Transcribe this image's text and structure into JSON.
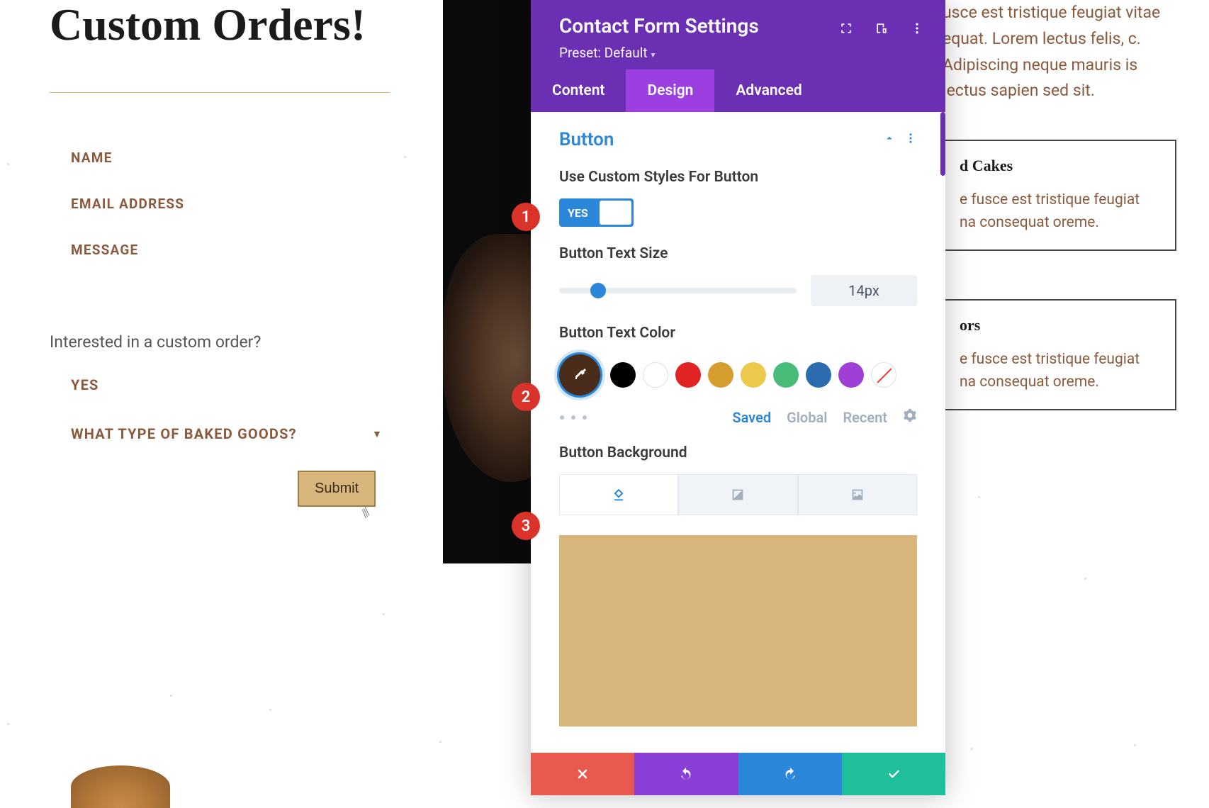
{
  "page": {
    "heading": "Custom Orders!",
    "form": {
      "name_label": "NAME",
      "email_label": "EMAIL ADDRESS",
      "message_label": "MESSAGE",
      "question": "Interested in a custom order?",
      "yes_option": "YES",
      "select_label": "WHAT TYPE OF BAKED GOODS?",
      "submit_label": "Submit"
    },
    "right_paragraph": "usce est tristique feugiat vitae equat. Lorem lectus felis, c. Adipiscing neque mauris is lectus sapien sed sit.",
    "card1": {
      "title": "d Cakes",
      "text": "e fusce est tristique feugiat na consequat oreme."
    },
    "card2": {
      "title": "ors",
      "text": "e fusce est tristique feugiat na consequat oreme."
    }
  },
  "panel": {
    "title": "Contact Form Settings",
    "preset": "Preset: Default",
    "tabs": {
      "content": "Content",
      "design": "Design",
      "advanced": "Advanced"
    },
    "section": "Button",
    "options": {
      "custom_styles_label": "Use Custom Styles For Button",
      "toggle_value": "YES",
      "text_size_label": "Button Text Size",
      "text_size_value": "14px",
      "text_color_label": "Button Text Color",
      "background_label": "Button Background",
      "color_tabs": {
        "saved": "Saved",
        "global": "Global",
        "recent": "Recent"
      }
    },
    "colors": {
      "selected": "#4a2c1a",
      "palette": [
        "#000000",
        "#ffffff",
        "#e02424",
        "#d69e2e",
        "#ecc94b",
        "#48bb78",
        "#2b6cb0",
        "#9f3fd6"
      ],
      "bg_preview": "#d8b57a"
    }
  },
  "badges": [
    "1",
    "2",
    "3"
  ]
}
